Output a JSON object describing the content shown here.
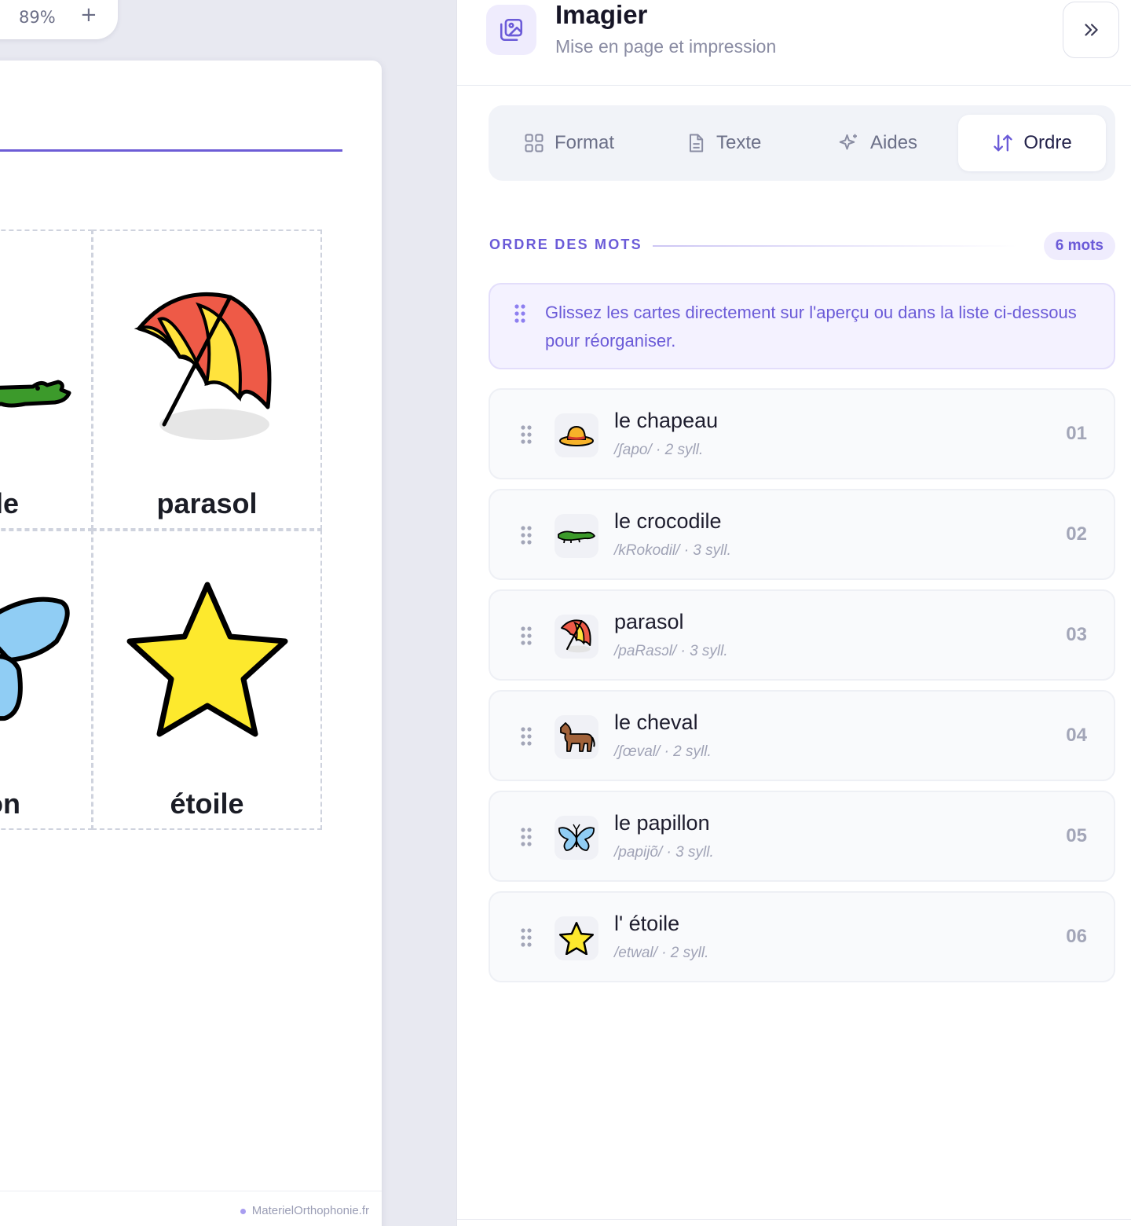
{
  "zoom": {
    "value": "89%",
    "plus": "+"
  },
  "preview": {
    "cards": [
      {
        "label": "dile"
      },
      {
        "label": "parasol"
      },
      {
        "label": "on"
      },
      {
        "label": "étoile"
      }
    ],
    "footer": "MaterielOrthophonie.fr"
  },
  "panel": {
    "title": "Imagier",
    "subtitle": "Mise en page et impression",
    "collapse_icon": "chevrons-right-icon",
    "tabs": [
      {
        "label": "Format",
        "icon": "grid-icon"
      },
      {
        "label": "Texte",
        "icon": "document-icon"
      },
      {
        "label": "Aides",
        "icon": "sparkle-icon"
      },
      {
        "label": "Ordre",
        "icon": "sort-arrows-icon",
        "active": true
      }
    ],
    "section": {
      "title": "ORDRE DES MOTS",
      "count": "6 mots"
    },
    "hint": "Glissez les cartes directement sur l'aperçu ou dans la liste ci-dessous pour réorganiser.",
    "words": [
      {
        "word": "le chapeau",
        "phon": "/ʃapo/ · 2 syll.",
        "num": "01",
        "icon": "hat-icon"
      },
      {
        "word": "le crocodile",
        "phon": "/kRokodil/ · 3 syll.",
        "num": "02",
        "icon": "crocodile-icon"
      },
      {
        "word": "parasol",
        "phon": "/paRasɔl/ · 3 syll.",
        "num": "03",
        "icon": "parasol-icon"
      },
      {
        "word": "le cheval",
        "phon": "/ʃœval/ · 2 syll.",
        "num": "04",
        "icon": "horse-icon"
      },
      {
        "word": "le papillon",
        "phon": "/papijõ/ · 3 syll.",
        "num": "05",
        "icon": "butterfly-icon"
      },
      {
        "word": "l' étoile",
        "phon": "/etwal/ · 2 syll.",
        "num": "06",
        "icon": "star-icon"
      }
    ]
  },
  "colors": {
    "accent": "#6b5bd8",
    "accent_soft": "#efecfd",
    "muted": "#a3a6b8"
  }
}
